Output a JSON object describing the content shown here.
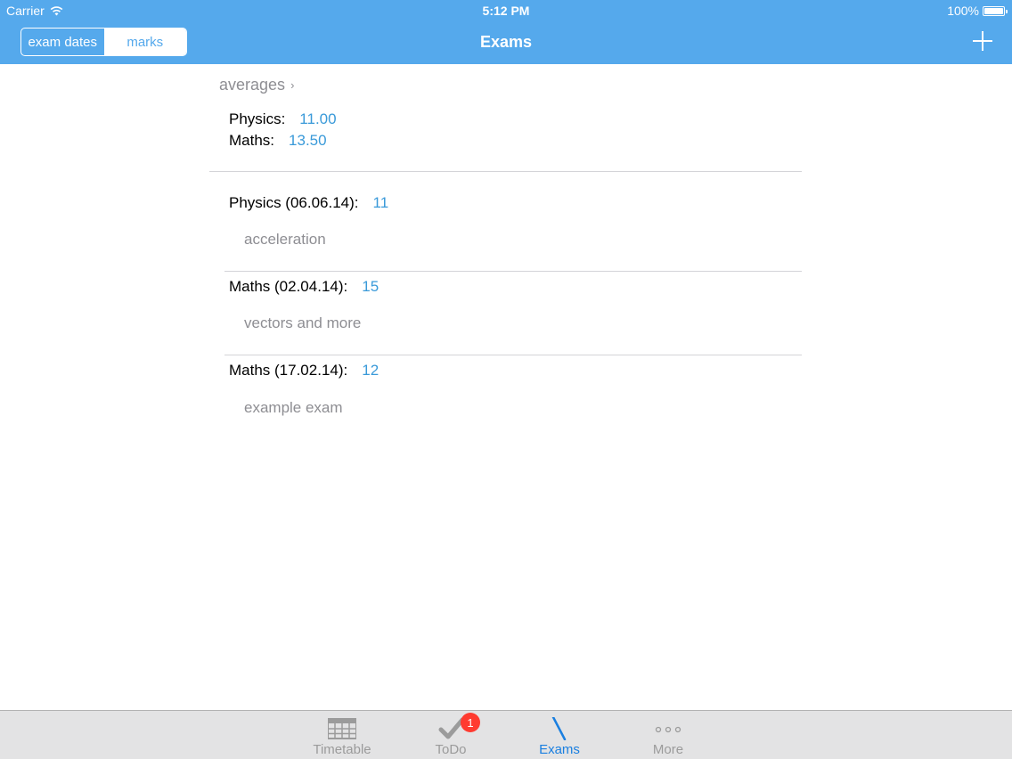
{
  "status_bar": {
    "carrier": "Carrier",
    "time": "5:12 PM",
    "battery": "100%"
  },
  "nav": {
    "title": "Exams",
    "segments": [
      "exam dates",
      "marks"
    ],
    "selected_segment": "marks",
    "add_icon": "plus-icon",
    "bar_color": "#55a9ec"
  },
  "averages": {
    "link_label": "averages",
    "items": [
      {
        "subject": "Physics:",
        "value": "11.00"
      },
      {
        "subject": "Maths:",
        "value": "13.50"
      }
    ]
  },
  "exams": [
    {
      "title": "Physics (06.06.14):",
      "mark": "11",
      "description": "acceleration"
    },
    {
      "title": "Maths (02.04.14):",
      "mark": "15",
      "description": "vectors and more"
    },
    {
      "title": "Maths (17.02.14):",
      "mark": "12",
      "description": "example exam"
    }
  ],
  "tabbar": {
    "tabs": [
      {
        "label": "Timetable",
        "icon": "timetable-icon",
        "active": false
      },
      {
        "label": "ToDo",
        "icon": "checkmark-icon",
        "active": false
      },
      {
        "label": "Exams",
        "icon": "pen-icon",
        "active": true
      },
      {
        "label": "More",
        "icon": "more-icon",
        "active": false
      }
    ],
    "todo_badge": "1",
    "active_color": "#1a7fe0",
    "badge_color": "#ff3b30"
  },
  "colors": {
    "value_blue": "#3a9ad9",
    "secondary_gray": "#8e8e93"
  }
}
